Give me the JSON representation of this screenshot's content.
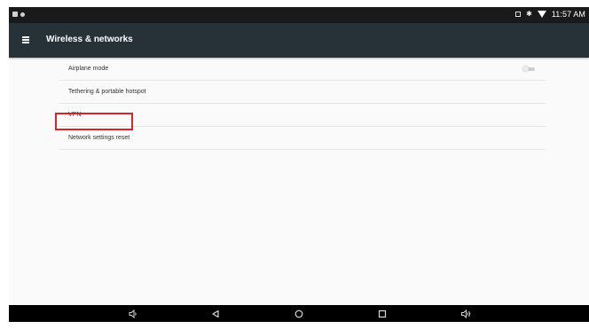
{
  "status_bar": {
    "time": "11:57 AM",
    "left_icons": [
      "notification-icon",
      "notification-icon"
    ],
    "right_icons": [
      "vibrate-icon",
      "bluetooth-icon",
      "wifi-icon"
    ]
  },
  "app_bar": {
    "title": "Wireless & networks",
    "menu_icon": "menu-icon"
  },
  "settings": {
    "items": [
      {
        "label": "Airplane mode",
        "has_toggle": true,
        "toggle_on": false
      },
      {
        "label": "Tethering & portable hotspot"
      },
      {
        "label": "VPN"
      },
      {
        "label": "Network settings reset",
        "highlighted": true
      }
    ]
  },
  "nav_bar": {
    "buttons": [
      "volume-down-icon",
      "back-icon",
      "home-icon",
      "recents-icon",
      "volume-up-icon"
    ]
  },
  "colors": {
    "app_bar": "#263238",
    "status_bar": "#1a1a1a",
    "highlight": "#d9222a",
    "background": "#fafafa"
  }
}
